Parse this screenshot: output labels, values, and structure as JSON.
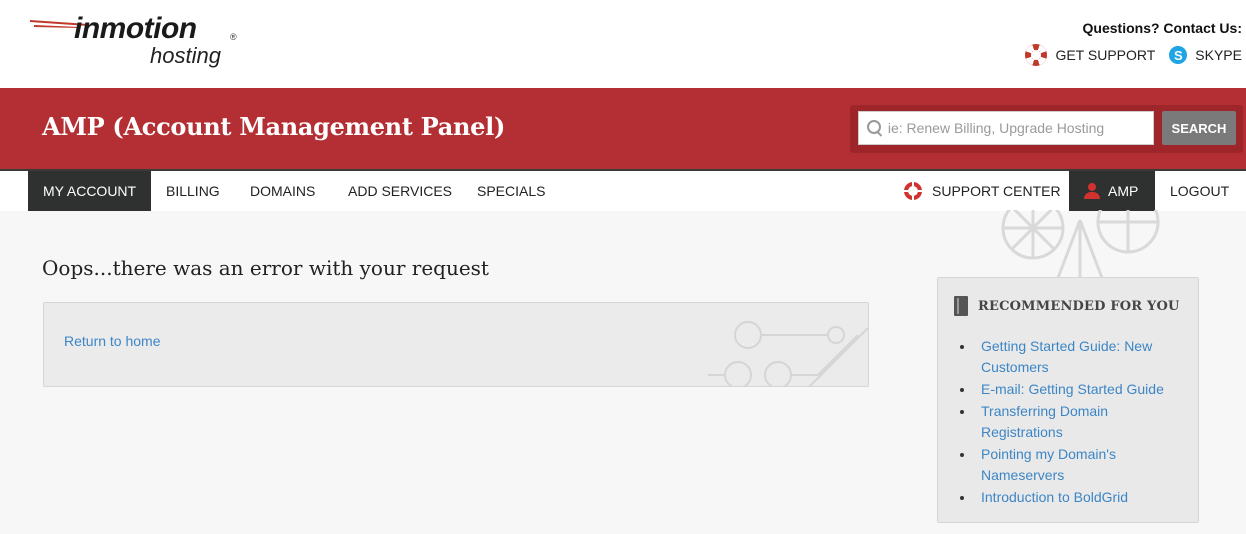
{
  "brand": {
    "name": "inmotion",
    "sub": "hosting",
    "reg": "®"
  },
  "contact": {
    "question": "Questions? Contact Us:",
    "support": "GET SUPPORT",
    "skype": "SKYPE",
    "skype_glyph": "S"
  },
  "banner": {
    "title": "AMP (Account Management Panel)"
  },
  "search": {
    "placeholder": "ie: Renew Billing, Upgrade Hosting",
    "value": "",
    "button": "SEARCH"
  },
  "nav": {
    "left": [
      "MY ACCOUNT",
      "BILLING",
      "DOMAINS",
      "ADD SERVICES",
      "SPECIALS"
    ],
    "support_center": "SUPPORT CENTER",
    "amp": "AMP",
    "logout": "LOGOUT"
  },
  "main": {
    "error_title": "Oops...there was an error with your request",
    "return_link": "Return to home"
  },
  "recommended": {
    "heading": "RECOMMENDED FOR YOU",
    "items": [
      "Getting Started Guide: New Customers",
      "E-mail: Getting Started Guide",
      "Transferring Domain Registrations",
      "Pointing my Domain's Nameservers",
      "Introduction to BoldGrid"
    ]
  },
  "colors": {
    "brand_red": "#b42f34",
    "nav_active": "#2f3030",
    "link": "#3d86c6",
    "icons": [
      "lifebuoy-icon",
      "skype-icon",
      "search-icon",
      "person-icon",
      "book-icon"
    ]
  }
}
